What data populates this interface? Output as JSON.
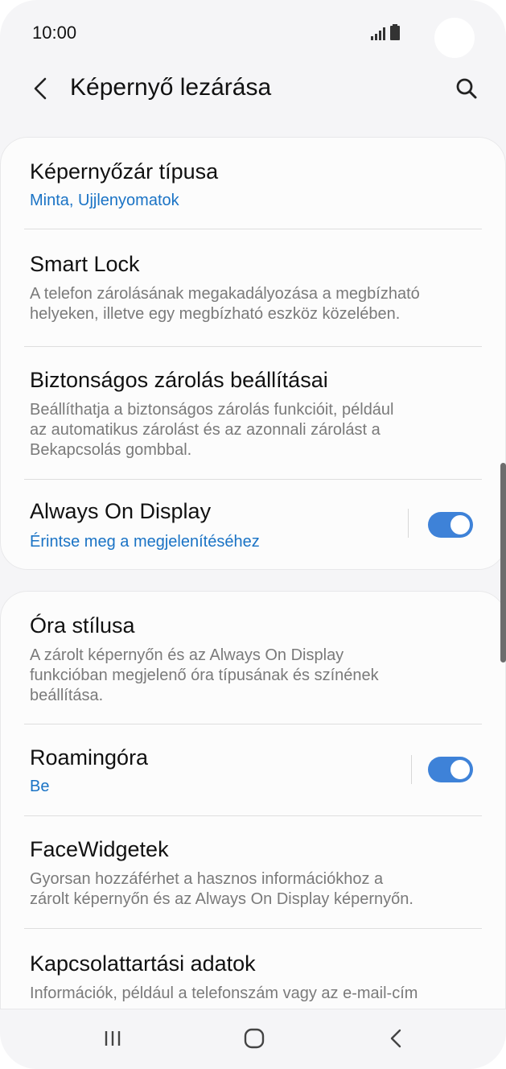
{
  "status_bar": {
    "time": "10:00",
    "icons": [
      "signal-icon",
      "battery-icon"
    ]
  },
  "app_bar": {
    "title": "Képernyő lezárása",
    "back_icon": "back-arrow-icon",
    "search_icon": "search-icon"
  },
  "sections": [
    {
      "items": [
        {
          "title": "Képernyőzár típusa",
          "subtitle": "Minta, Ujjlenyomatok"
        },
        {
          "title": "Smart Lock",
          "description": [
            "A telefon zárolásának megakadályozása a megbízható",
            "helyeken, illetve egy megbízható eszköz közelében."
          ]
        },
        {
          "title": "Biztonságos zárolás beállításai",
          "description": [
            "Beállíthatja a biztonságos zárolás funkcióit, például",
            "az automatikus zárolást és az azonnali zárolást a",
            "Bekapcsolás gombbal."
          ]
        },
        {
          "title": "Always On Display",
          "subtitle": "Érintse meg a megjelenítéséhez",
          "toggle": true
        }
      ]
    },
    {
      "items": [
        {
          "title": "Óra stílusa",
          "description": [
            "A zárolt képernyőn és az Always On Display",
            "funkcióban megjelenő óra típusának és színének",
            "beállítása."
          ]
        },
        {
          "title": "Roamingóra",
          "subtitle": "Be",
          "toggle": true
        },
        {
          "title": "FaceWidgetek",
          "description": [
            "Gyorsan hozzáférhet a hasznos információkhoz a",
            "zárolt képernyőn és az Always On Display képernyőn."
          ]
        },
        {
          "title": "Kapcsolattartási adatok",
          "description": [
            "Információk, például a telefonszám vagy az e-mail-cím"
          ]
        }
      ]
    }
  ],
  "colors": {
    "accent": "#3e82d8",
    "link": "#1a73c5",
    "background": "#f5f5f7",
    "card": "#fcfcfc"
  },
  "nav_bar": {
    "icons": [
      "recent-apps-icon",
      "home-icon",
      "back-icon"
    ]
  }
}
